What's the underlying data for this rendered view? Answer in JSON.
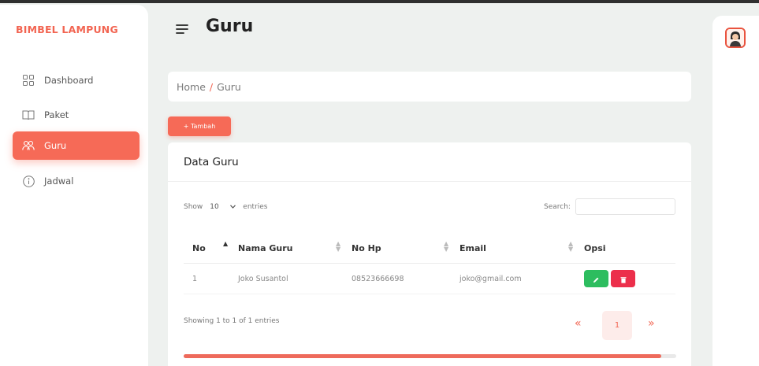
{
  "sidebar": {
    "brand": "BIMBEL LAMPUNG",
    "items": [
      {
        "label": "Dashboard",
        "icon": "grid-icon"
      },
      {
        "label": "Paket",
        "icon": "book-icon"
      },
      {
        "label": "Guru",
        "icon": "users-icon",
        "active": true
      },
      {
        "label": "Jadwal",
        "icon": "info-icon"
      }
    ]
  },
  "header": {
    "title": "Guru",
    "menu_icon": "hamburger-icon"
  },
  "breadcrumb": {
    "home": "Home",
    "separator": "/",
    "current": "Guru"
  },
  "actions": {
    "add_label": "+ Tambah"
  },
  "table_card": {
    "title": "Data Guru",
    "show_label": "Show",
    "entries_value": "10",
    "entries_label": "entries",
    "search_label": "Search:",
    "columns": [
      "No",
      "Nama Guru",
      "No Hp",
      "Email",
      "Opsi"
    ],
    "rows": [
      {
        "no": "1",
        "nama": "Joko Susantol",
        "hp": "08523666698",
        "email": "joko@gmail.com"
      }
    ],
    "info": "Showing 1 to 1 of 1 entries",
    "pagination": {
      "prev": "«",
      "current": "1",
      "next": "»"
    },
    "scroll_progress": 0.97
  },
  "colors": {
    "accent": "#f66a57",
    "edit": "#2dbd5f",
    "delete": "#ec2f4b"
  }
}
